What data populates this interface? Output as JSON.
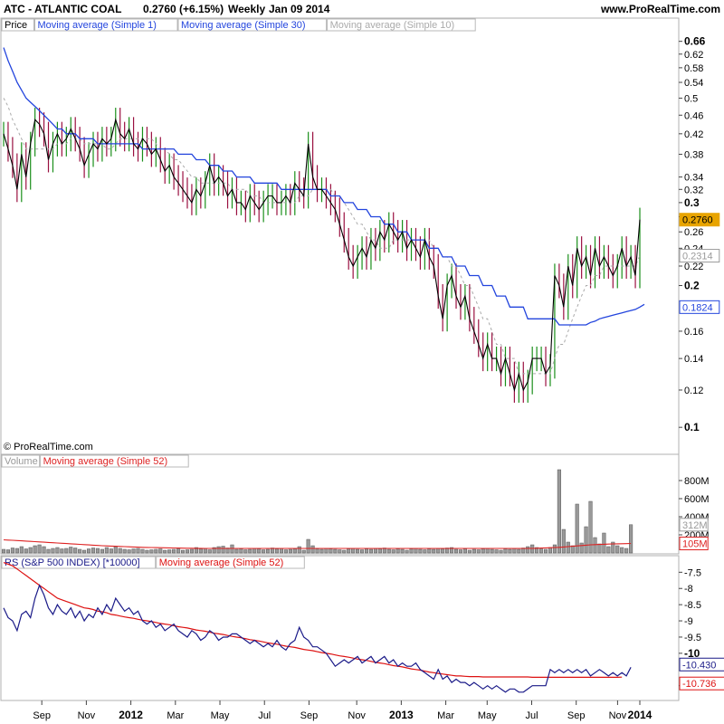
{
  "header": {
    "instrument": "ATC - ATLANTIC COAL",
    "change": "0.2760 (+6.15%)",
    "period": "Weekly",
    "date": "Jan 09 2014",
    "site": "www.ProRealTime.com",
    "copyright": "© ProRealTime.com"
  },
  "colors": {
    "up": "#1a8f1a",
    "down": "#9a1040",
    "close_line": "#000000",
    "ma30": "#2244dd",
    "ma10": "#aaaaaa",
    "volume": "#999999",
    "volume_ma": "#dd2222",
    "rs": "#1a1a88",
    "rs_ma": "#dd1111"
  },
  "chart_data": [
    {
      "type": "line",
      "panel": "price",
      "legend": [
        "Price",
        "Moving average (Simple 1)",
        "Moving average (Simple 30)",
        "Moving average (Simple 10)"
      ],
      "yscale": "log",
      "ylim": [
        0.09,
        0.72
      ],
      "yticks": [
        "0.66",
        "0.62",
        "0.58",
        "0.54",
        "0.5",
        "0.46",
        "0.42",
        "0.38",
        "0.34",
        "0.32",
        "0.3",
        "0.28",
        "0.26",
        "0.24",
        "0.22",
        "0.2",
        "0.16",
        "0.14",
        "0.12",
        "0.1"
      ],
      "ytick_values": [
        0.66,
        0.62,
        0.58,
        0.54,
        0.5,
        0.46,
        0.42,
        0.38,
        0.34,
        0.32,
        0.3,
        0.28,
        0.26,
        0.24,
        0.22,
        0.2,
        0.16,
        0.14,
        0.12,
        0.1
      ],
      "bold_ticks": [
        "0.66",
        "0.3",
        "0.2",
        "0.1"
      ],
      "xlabels": [
        "Sep",
        "Nov",
        "2012",
        "Mar",
        "May",
        "Jul",
        "Sep",
        "Nov",
        "2013",
        "Mar",
        "May",
        "Jul",
        "Sep",
        "Nov",
        "2014"
      ],
      "xlabel_positions": [
        0.06,
        0.13,
        0.2,
        0.27,
        0.34,
        0.41,
        0.48,
        0.555,
        0.625,
        0.695,
        0.76,
        0.83,
        0.9,
        0.965,
        1.0
      ],
      "close": [
        0.42,
        0.39,
        0.36,
        0.32,
        0.38,
        0.34,
        0.4,
        0.45,
        0.44,
        0.42,
        0.37,
        0.4,
        0.42,
        0.4,
        0.41,
        0.43,
        0.41,
        0.39,
        0.36,
        0.38,
        0.4,
        0.39,
        0.41,
        0.4,
        0.41,
        0.45,
        0.42,
        0.41,
        0.43,
        0.4,
        0.39,
        0.41,
        0.4,
        0.38,
        0.39,
        0.37,
        0.35,
        0.36,
        0.34,
        0.33,
        0.32,
        0.31,
        0.3,
        0.32,
        0.31,
        0.33,
        0.36,
        0.33,
        0.34,
        0.33,
        0.31,
        0.32,
        0.3,
        0.3,
        0.29,
        0.31,
        0.3,
        0.29,
        0.3,
        0.31,
        0.31,
        0.3,
        0.3,
        0.31,
        0.3,
        0.33,
        0.32,
        0.31,
        0.4,
        0.34,
        0.32,
        0.32,
        0.31,
        0.3,
        0.29,
        0.27,
        0.25,
        0.23,
        0.22,
        0.23,
        0.24,
        0.23,
        0.25,
        0.24,
        0.26,
        0.25,
        0.27,
        0.26,
        0.25,
        0.26,
        0.24,
        0.25,
        0.24,
        0.23,
        0.25,
        0.23,
        0.22,
        0.19,
        0.17,
        0.2,
        0.21,
        0.19,
        0.18,
        0.19,
        0.17,
        0.16,
        0.15,
        0.14,
        0.15,
        0.14,
        0.14,
        0.13,
        0.14,
        0.13,
        0.12,
        0.13,
        0.12,
        0.125,
        0.14,
        0.14,
        0.14,
        0.13,
        0.135,
        0.21,
        0.2,
        0.18,
        0.22,
        0.2,
        0.24,
        0.22,
        0.23,
        0.21,
        0.24,
        0.22,
        0.23,
        0.22,
        0.21,
        0.22,
        0.24,
        0.22,
        0.23,
        0.21,
        0.276
      ],
      "ma10": [
        0.5,
        0.48,
        0.45,
        0.43,
        0.41,
        0.39,
        0.39,
        0.39,
        0.39,
        0.39,
        0.39,
        0.39,
        0.4,
        0.4,
        0.4,
        0.41,
        0.41,
        0.41,
        0.4,
        0.4,
        0.4,
        0.4,
        0.4,
        0.39,
        0.39,
        0.4,
        0.41,
        0.41,
        0.41,
        0.41,
        0.41,
        0.41,
        0.41,
        0.41,
        0.4,
        0.39,
        0.39,
        0.38,
        0.37,
        0.37,
        0.36,
        0.35,
        0.34,
        0.34,
        0.33,
        0.33,
        0.33,
        0.33,
        0.33,
        0.33,
        0.33,
        0.32,
        0.32,
        0.32,
        0.32,
        0.31,
        0.31,
        0.31,
        0.3,
        0.3,
        0.3,
        0.3,
        0.3,
        0.3,
        0.3,
        0.3,
        0.31,
        0.31,
        0.31,
        0.32,
        0.32,
        0.32,
        0.32,
        0.32,
        0.31,
        0.31,
        0.3,
        0.29,
        0.28,
        0.27,
        0.27,
        0.26,
        0.25,
        0.25,
        0.24,
        0.24,
        0.24,
        0.25,
        0.25,
        0.25,
        0.25,
        0.25,
        0.25,
        0.25,
        0.25,
        0.25,
        0.24,
        0.24,
        0.23,
        0.23,
        0.22,
        0.22,
        0.21,
        0.2,
        0.2,
        0.19,
        0.18,
        0.17,
        0.17,
        0.16,
        0.15,
        0.15,
        0.14,
        0.14,
        0.14,
        0.13,
        0.13,
        0.13,
        0.13,
        0.13,
        0.13,
        0.13,
        0.13,
        0.14,
        0.15,
        0.15,
        0.16,
        0.17,
        0.18,
        0.19,
        0.2,
        0.2,
        0.21,
        0.21,
        0.22,
        0.22,
        0.22,
        0.22,
        0.22,
        0.22,
        0.22,
        0.22,
        0.2314
      ],
      "ma30": [
        0.64,
        0.6,
        0.57,
        0.54,
        0.52,
        0.5,
        0.49,
        0.48,
        0.47,
        0.46,
        0.45,
        0.44,
        0.43,
        0.43,
        0.42,
        0.42,
        0.42,
        0.41,
        0.41,
        0.41,
        0.41,
        0.4,
        0.4,
        0.4,
        0.4,
        0.4,
        0.4,
        0.4,
        0.4,
        0.4,
        0.4,
        0.39,
        0.39,
        0.39,
        0.39,
        0.39,
        0.39,
        0.39,
        0.39,
        0.38,
        0.38,
        0.38,
        0.38,
        0.37,
        0.37,
        0.37,
        0.36,
        0.36,
        0.36,
        0.35,
        0.35,
        0.35,
        0.34,
        0.34,
        0.34,
        0.34,
        0.33,
        0.33,
        0.33,
        0.33,
        0.33,
        0.33,
        0.32,
        0.32,
        0.32,
        0.32,
        0.32,
        0.32,
        0.32,
        0.32,
        0.32,
        0.32,
        0.32,
        0.31,
        0.31,
        0.31,
        0.3,
        0.3,
        0.3,
        0.29,
        0.29,
        0.29,
        0.28,
        0.28,
        0.28,
        0.27,
        0.27,
        0.27,
        0.26,
        0.26,
        0.26,
        0.25,
        0.25,
        0.25,
        0.25,
        0.24,
        0.24,
        0.24,
        0.23,
        0.23,
        0.23,
        0.22,
        0.22,
        0.22,
        0.21,
        0.21,
        0.21,
        0.2,
        0.2,
        0.2,
        0.19,
        0.19,
        0.19,
        0.18,
        0.18,
        0.18,
        0.18,
        0.17,
        0.17,
        0.17,
        0.17,
        0.17,
        0.17,
        0.17,
        0.165,
        0.165,
        0.165,
        0.165,
        0.165,
        0.165,
        0.165,
        0.167,
        0.168,
        0.17,
        0.171,
        0.172,
        0.173,
        0.174,
        0.175,
        0.176,
        0.177,
        0.178,
        0.18,
        0.1824
      ],
      "last_labels": [
        "0.2760",
        "0.2314",
        "0.1824"
      ]
    },
    {
      "type": "bar",
      "panel": "volume",
      "legend": [
        "Volume",
        "Moving average (Simple 52)"
      ],
      "ylim": [
        0,
        950
      ],
      "yticks": [
        "800M",
        "600M",
        "400M",
        "200M"
      ],
      "ytick_values": [
        800,
        600,
        400,
        200
      ],
      "values": [
        40,
        35,
        55,
        50,
        70,
        45,
        60,
        80,
        90,
        70,
        40,
        50,
        60,
        45,
        50,
        65,
        55,
        40,
        30,
        45,
        55,
        50,
        40,
        60,
        45,
        70,
        50,
        40,
        35,
        45,
        50,
        40,
        30,
        35,
        40,
        45,
        30,
        35,
        40,
        45,
        30,
        35,
        40,
        60,
        45,
        50,
        35,
        60,
        70,
        75,
        55,
        90,
        40,
        45,
        35,
        40,
        50,
        45,
        35,
        40,
        55,
        45,
        50,
        35,
        40,
        45,
        70,
        30,
        150,
        80,
        45,
        40,
        50,
        45,
        40,
        35,
        30,
        45,
        50,
        40,
        35,
        45,
        40,
        50,
        45,
        55,
        40,
        35,
        45,
        40,
        30,
        45,
        50,
        40,
        35,
        45,
        40,
        50,
        45,
        55,
        60,
        40,
        35,
        45,
        30,
        40,
        35,
        45,
        50,
        40,
        35,
        30,
        45,
        40,
        50,
        40,
        55,
        70,
        90,
        60,
        45,
        40,
        60,
        90,
        920,
        260,
        120,
        80,
        540,
        110,
        290,
        570,
        170,
        100,
        220,
        70,
        120,
        80,
        60,
        50,
        312
      ],
      "ma52": [
        145,
        142,
        140,
        137,
        134,
        131,
        128,
        125,
        122,
        119,
        116,
        113,
        110,
        107,
        104,
        101,
        98,
        95,
        92,
        89,
        86,
        83,
        80,
        78,
        76,
        74,
        72,
        70,
        68,
        66,
        64,
        62,
        61,
        60,
        59,
        58,
        57,
        56,
        55,
        54,
        53,
        52,
        52,
        51,
        51,
        50,
        50,
        50,
        50,
        50,
        50,
        50,
        50,
        50,
        50,
        50,
        50,
        50,
        50,
        50,
        50,
        50,
        50,
        50,
        50,
        50,
        50,
        50,
        50,
        50,
        50,
        50,
        50,
        50,
        50,
        50,
        50,
        50,
        50,
        50,
        50,
        50,
        50,
        50,
        50,
        50,
        50,
        50,
        50,
        50,
        50,
        50,
        50,
        50,
        50,
        50,
        50,
        50,
        50,
        50,
        50,
        50,
        50,
        50,
        50,
        50,
        50,
        50,
        50,
        50,
        50,
        50,
        50,
        50,
        50,
        50,
        50,
        50,
        50,
        52,
        54,
        56,
        58,
        60,
        62,
        66,
        70,
        74,
        78,
        82,
        86,
        90,
        92,
        94,
        96,
        98,
        100,
        101,
        102,
        103,
        105
      ],
      "last_labels": [
        "312M",
        "105M"
      ]
    },
    {
      "type": "line",
      "panel": "rs",
      "legend": [
        "RS (S&P 500 INDEX) [*10000]",
        "Moving average (Simple 52)"
      ],
      "ylim": [
        -11.4,
        -7.1
      ],
      "yticks": [
        "-7.5",
        "-8",
        "-8.5",
        "-9",
        "-9.5",
        "-10",
        "-11"
      ],
      "ytick_values": [
        -7.5,
        -8,
        -8.5,
        -9,
        -9.5,
        -10,
        -11
      ],
      "bold_ticks": [
        "-10"
      ],
      "values": [
        -8.6,
        -8.9,
        -9.0,
        -9.3,
        -8.8,
        -8.7,
        -8.9,
        -8.3,
        -7.9,
        -8.2,
        -8.6,
        -8.8,
        -8.5,
        -8.7,
        -8.8,
        -8.6,
        -8.9,
        -8.7,
        -9.0,
        -8.8,
        -8.9,
        -8.6,
        -8.8,
        -8.5,
        -8.7,
        -8.3,
        -8.5,
        -8.7,
        -8.6,
        -8.8,
        -8.7,
        -9.0,
        -9.1,
        -9.0,
        -9.2,
        -9.1,
        -9.3,
        -9.2,
        -9.1,
        -9.3,
        -9.4,
        -9.5,
        -9.3,
        -9.4,
        -9.6,
        -9.5,
        -9.3,
        -9.4,
        -9.6,
        -9.5,
        -9.5,
        -9.4,
        -9.4,
        -9.5,
        -9.6,
        -9.7,
        -9.6,
        -9.7,
        -9.8,
        -9.7,
        -9.8,
        -9.6,
        -9.8,
        -9.9,
        -9.7,
        -9.6,
        -9.2,
        -9.5,
        -9.6,
        -9.8,
        -9.8,
        -9.9,
        -10.0,
        -10.2,
        -10.4,
        -10.3,
        -10.2,
        -10.3,
        -10.2,
        -10.1,
        -10.3,
        -10.2,
        -10.1,
        -10.3,
        -10.2,
        -10.1,
        -10.3,
        -10.2,
        -10.4,
        -10.3,
        -10.4,
        -10.4,
        -10.3,
        -10.5,
        -10.6,
        -10.7,
        -10.8,
        -10.5,
        -10.8,
        -10.7,
        -10.9,
        -10.8,
        -10.9,
        -10.9,
        -11.0,
        -10.9,
        -11.0,
        -11.1,
        -11.0,
        -11.1,
        -11.0,
        -11.1,
        -11.2,
        -11.1,
        -11.1,
        -11.2,
        -11.2,
        -11.1,
        -11.0,
        -11.0,
        -11.0,
        -11.0,
        -10.5,
        -10.6,
        -10.5,
        -10.6,
        -10.5,
        -10.6,
        -10.5,
        -10.6,
        -10.5,
        -10.7,
        -10.6,
        -10.5,
        -10.6,
        -10.7,
        -10.6,
        -10.7,
        -10.6,
        -10.7,
        -10.43
      ],
      "ma52": [
        -7.2,
        -7.25,
        -7.3,
        -7.4,
        -7.5,
        -7.6,
        -7.7,
        -7.8,
        -7.9,
        -8.0,
        -8.1,
        -8.2,
        -8.3,
        -8.35,
        -8.4,
        -8.45,
        -8.5,
        -8.55,
        -8.6,
        -8.62,
        -8.65,
        -8.7,
        -8.72,
        -8.75,
        -8.8,
        -8.82,
        -8.85,
        -8.88,
        -8.9,
        -8.92,
        -8.95,
        -8.98,
        -9.0,
        -9.02,
        -9.05,
        -9.08,
        -9.1,
        -9.12,
        -9.15,
        -9.18,
        -9.2,
        -9.22,
        -9.25,
        -9.28,
        -9.3,
        -9.32,
        -9.35,
        -9.38,
        -9.4,
        -9.42,
        -9.45,
        -9.48,
        -9.5,
        -9.52,
        -9.55,
        -9.58,
        -9.6,
        -9.62,
        -9.65,
        -9.68,
        -9.7,
        -9.72,
        -9.75,
        -9.78,
        -9.8,
        -9.82,
        -9.85,
        -9.88,
        -9.9,
        -9.92,
        -9.95,
        -9.98,
        -10.0,
        -10.02,
        -10.05,
        -10.08,
        -10.1,
        -10.12,
        -10.15,
        -10.18,
        -10.2,
        -10.22,
        -10.25,
        -10.28,
        -10.3,
        -10.32,
        -10.35,
        -10.38,
        -10.4,
        -10.42,
        -10.45,
        -10.48,
        -10.5,
        -10.52,
        -10.55,
        -10.58,
        -10.6,
        -10.62,
        -10.64,
        -10.66,
        -10.68,
        -10.7,
        -10.7,
        -10.71,
        -10.72,
        -10.72,
        -10.72,
        -10.73,
        -10.73,
        -10.73,
        -10.73,
        -10.73,
        -10.73,
        -10.73,
        -10.73,
        -10.73,
        -10.73,
        -10.73,
        -10.74,
        -10.74,
        -10.74,
        -10.74,
        -10.74,
        -10.74,
        -10.74,
        -10.74,
        -10.74,
        -10.74,
        -10.74,
        -10.74,
        -10.74,
        -10.74,
        -10.74,
        -10.74,
        -10.74,
        -10.74,
        -10.74,
        -10.74,
        -10.736
      ],
      "last_labels": [
        "-10.430",
        "-10.736"
      ]
    }
  ]
}
